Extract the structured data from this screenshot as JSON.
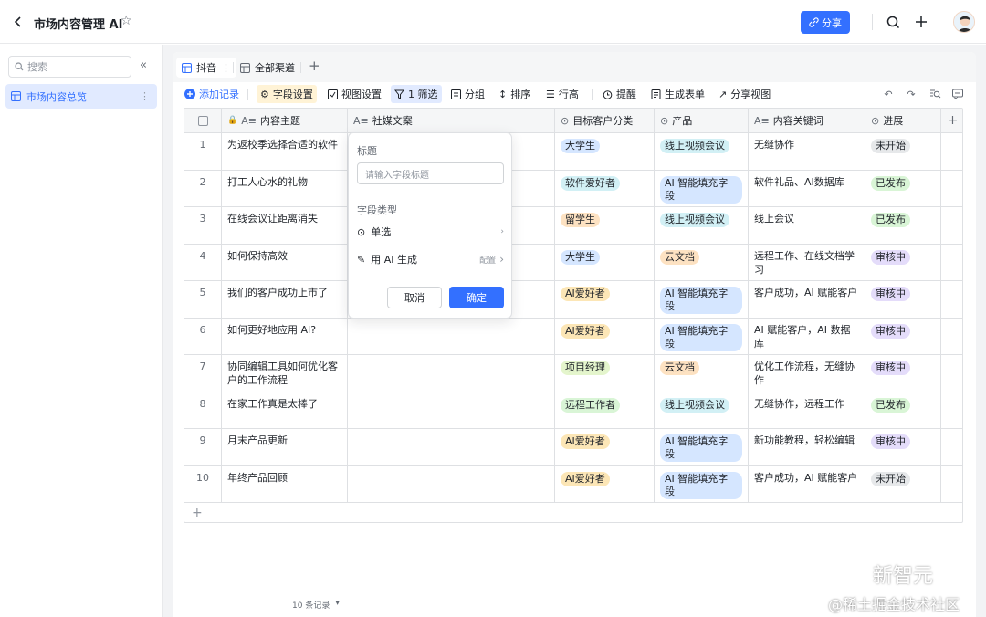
{
  "header": {
    "title": "市场内容管理 AI",
    "share_label": "分享"
  },
  "sidebar": {
    "search_placeholder": "搜索",
    "items": [
      {
        "label": "市场内容总览"
      }
    ]
  },
  "tabs": [
    {
      "label": "抖音"
    },
    {
      "label": "全部渠道"
    }
  ],
  "toolbar": {
    "add_record": "添加记录",
    "field_settings": "字段设置",
    "view_settings": "视图设置",
    "filter": "1 筛选",
    "group": "分组",
    "sort": "排序",
    "row_height": "行高",
    "remind": "提醒",
    "form": "生成表单",
    "share_view": "分享视图"
  },
  "columns": [
    "内容主题",
    "社媒文案",
    "目标客户分类",
    "产品",
    "内容关键词",
    "进展"
  ],
  "rows": [
    {
      "n": "1",
      "topic": "为返校季选择合适的软件",
      "customer": "大学生",
      "product": "线上视频会议",
      "keywords": "无缝协作",
      "status": "未开始"
    },
    {
      "n": "2",
      "topic": "打工人心水的礼物",
      "customer": "软件爱好者",
      "product": "AI 智能填充字段",
      "keywords": "软件礼品、AI数据库",
      "status": "已发布"
    },
    {
      "n": "3",
      "topic": "在线会议让距离消失",
      "customer": "留学生",
      "product": "线上视频会议",
      "keywords": "线上会议",
      "status": "已发布"
    },
    {
      "n": "4",
      "topic": "如何保持高效",
      "customer": "大学生",
      "product": "云文档",
      "keywords": "远程工作、在线文档学习",
      "status": "审核中"
    },
    {
      "n": "5",
      "topic": "我们的客户成功上市了",
      "customer": "AI爱好者",
      "product": "AI 智能填充字段",
      "keywords": "客户成功，AI 赋能客户",
      "status": "审核中"
    },
    {
      "n": "6",
      "topic": "如何更好地应用 AI?",
      "customer": "AI爱好者",
      "product": "AI 智能填充字段",
      "keywords": "AI 赋能客户，AI 数据库",
      "status": "审核中"
    },
    {
      "n": "7",
      "topic": "协同编辑工具如何优化客户的工作流程",
      "customer": "项目经理",
      "product": "云文档",
      "keywords": "优化工作流程，无缝协作",
      "status": "审核中"
    },
    {
      "n": "8",
      "topic": "在家工作真是太棒了",
      "customer": "远程工作者",
      "product": "线上视频会议",
      "keywords": "无缝协作，远程工作",
      "status": "已发布"
    },
    {
      "n": "9",
      "topic": "月末产品更新",
      "customer": "AI爱好者",
      "product": "AI 智能填充字段",
      "keywords": "新功能教程，轻松编辑",
      "status": "审核中"
    },
    {
      "n": "10",
      "topic": "年终产品回顾",
      "customer": "AI爱好者",
      "product": "AI 智能填充字段",
      "keywords": "客户成功，AI 赋能客户",
      "status": "未开始"
    }
  ],
  "popup": {
    "title_label": "标题",
    "input_placeholder": "请输入字段标题",
    "type_label": "字段类型",
    "option_single": "单选",
    "option_ai": "用 AI 生成",
    "config": "配置",
    "cancel": "取消",
    "confirm": "确定"
  },
  "footer": {
    "record_count": "10 条记录"
  },
  "watermark": {
    "line1": "新智元",
    "line2": "@稀土掘金技术社区"
  },
  "colors": {
    "accent": "#3370ff"
  }
}
